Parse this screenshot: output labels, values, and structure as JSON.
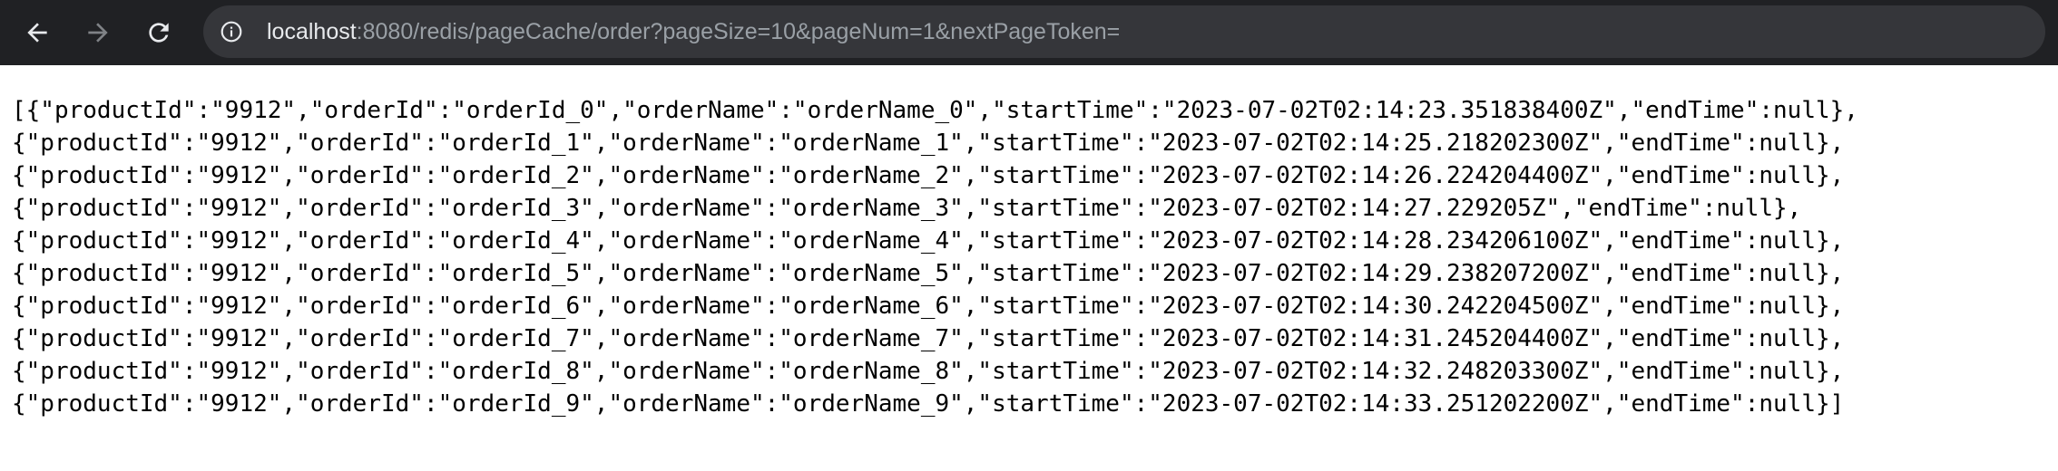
{
  "browser": {
    "url_host": "localhost",
    "url_rest": ":8080/redis/pageCache/order?pageSize=10&pageNum=1&nextPageToken=",
    "icons": {
      "back": "arrow-left-icon",
      "forward": "arrow-right-icon",
      "reload": "reload-icon",
      "site_info": "info-icon"
    },
    "colors": {
      "toolbar_bg": "#202124",
      "omnibox_bg": "#35363a",
      "host_text": "#e8eaed",
      "path_text": "#9aa0a6",
      "forward_disabled": "#7f8286"
    }
  },
  "page": {
    "lines": [
      "[{\"productId\":\"9912\",\"orderId\":\"orderId_0\",\"orderName\":\"orderName_0\",\"startTime\":\"2023-07-02T02:14:23.351838400Z\",\"endTime\":null},",
      "{\"productId\":\"9912\",\"orderId\":\"orderId_1\",\"orderName\":\"orderName_1\",\"startTime\":\"2023-07-02T02:14:25.218202300Z\",\"endTime\":null},",
      "{\"productId\":\"9912\",\"orderId\":\"orderId_2\",\"orderName\":\"orderName_2\",\"startTime\":\"2023-07-02T02:14:26.224204400Z\",\"endTime\":null},",
      "{\"productId\":\"9912\",\"orderId\":\"orderId_3\",\"orderName\":\"orderName_3\",\"startTime\":\"2023-07-02T02:14:27.229205Z\",\"endTime\":null},",
      "{\"productId\":\"9912\",\"orderId\":\"orderId_4\",\"orderName\":\"orderName_4\",\"startTime\":\"2023-07-02T02:14:28.234206100Z\",\"endTime\":null},",
      "{\"productId\":\"9912\",\"orderId\":\"orderId_5\",\"orderName\":\"orderName_5\",\"startTime\":\"2023-07-02T02:14:29.238207200Z\",\"endTime\":null},",
      "{\"productId\":\"9912\",\"orderId\":\"orderId_6\",\"orderName\":\"orderName_6\",\"startTime\":\"2023-07-02T02:14:30.242204500Z\",\"endTime\":null},",
      "{\"productId\":\"9912\",\"orderId\":\"orderId_7\",\"orderName\":\"orderName_7\",\"startTime\":\"2023-07-02T02:14:31.245204400Z\",\"endTime\":null},",
      "{\"productId\":\"9912\",\"orderId\":\"orderId_8\",\"orderName\":\"orderName_8\",\"startTime\":\"2023-07-02T02:14:32.248203300Z\",\"endTime\":null},",
      "{\"productId\":\"9912\",\"orderId\":\"orderId_9\",\"orderName\":\"orderName_9\",\"startTime\":\"2023-07-02T02:14:33.251202200Z\",\"endTime\":null}]"
    ]
  }
}
